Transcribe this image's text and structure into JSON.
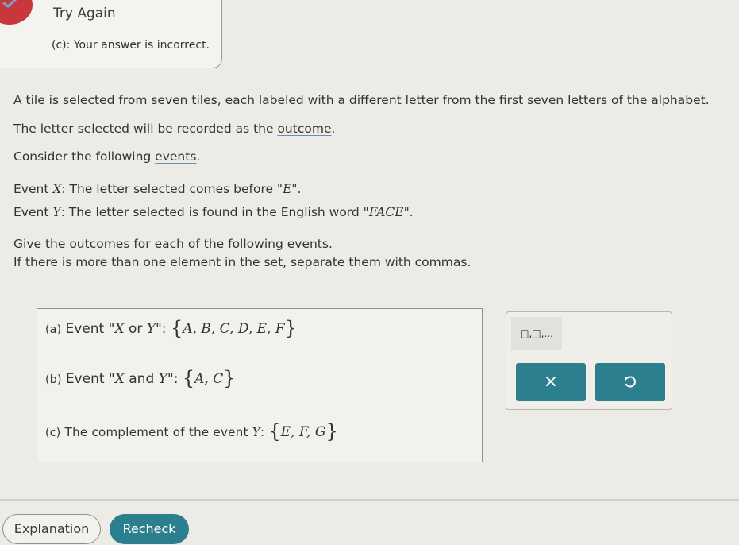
{
  "alert": {
    "title": "Try Again",
    "message": "(c): Your answer is incorrect."
  },
  "problem": {
    "p1": "A tile is selected from seven tiles, each labeled with a different letter from the first seven letters of the alphabet.",
    "p2_before": "The letter selected will be recorded as the ",
    "p2_link": "outcome",
    "p2_after": ".",
    "p3_before": "Consider the following ",
    "p3_link": "events",
    "p3_after": ".",
    "eventX_prefix": "Event ",
    "eventX_var": "X",
    "eventX_mid": ": The letter selected comes before \"",
    "eventX_letter": "E",
    "eventX_end": "\".",
    "eventY_prefix": "Event ",
    "eventY_var": "Y",
    "eventY_mid": ": The letter selected is found in the English word \"",
    "eventY_word": "FACE",
    "eventY_end": "\".",
    "instr1": "Give the outcomes for each of the following events.",
    "instr2_before": "If there is more than one element in the ",
    "instr2_link": "set",
    "instr2_after": ", separate them with commas."
  },
  "answers": {
    "a_label": "(a)",
    "a_text_pre": "Event \"",
    "a_var1": "X",
    "a_op": " or ",
    "a_var2": "Y",
    "a_text_post": "\": ",
    "a_value": "A, B, C, D, E, F",
    "b_label": "(b)",
    "b_text_pre": "Event \"",
    "b_var1": "X",
    "b_op": " and ",
    "b_var2": "Y",
    "b_text_post": "\": ",
    "b_value": "A, C",
    "c_label": "(c)",
    "c_text_pre": "The ",
    "c_link": "complement",
    "c_text_mid": " of the event ",
    "c_var": "Y",
    "c_text_post": ": ",
    "c_value": "E, F, G"
  },
  "toolbox": {
    "set_tool_label": "□,□,...",
    "clear_symbol": "×",
    "undo_icon": "undo-icon"
  },
  "footer": {
    "explanation_label": "Explanation",
    "recheck_label": "Recheck"
  },
  "colors": {
    "accent": "#2c7f8f",
    "error": "#c8383a",
    "background": "#ecebe6"
  }
}
